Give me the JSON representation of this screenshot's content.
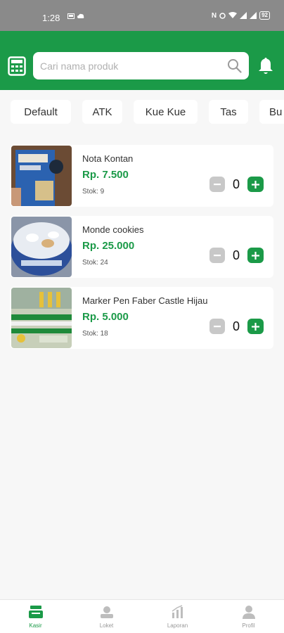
{
  "status_bar": {
    "time": "1:28",
    "battery": "92"
  },
  "search": {
    "placeholder": "Cari nama produk"
  },
  "categories": [
    "Default",
    "ATK",
    "Kue Kue",
    "Tas",
    "Bu"
  ],
  "products": [
    {
      "name": "Nota Kontan",
      "price": "Rp. 7.500",
      "stock": "Stok: 9",
      "qty": "0"
    },
    {
      "name": "Monde cookies",
      "price": "Rp. 25.000",
      "stock": "Stok: 24",
      "qty": "0"
    },
    {
      "name": "Marker Pen Faber Castle Hijau",
      "price": "Rp. 5.000",
      "stock": "Stok: 18",
      "qty": "0"
    }
  ],
  "nav": [
    {
      "label": "Kasir",
      "icon": "cash-register-icon",
      "active": true
    },
    {
      "label": "Loket",
      "icon": "counter-icon",
      "active": false
    },
    {
      "label": "Laporan",
      "icon": "report-chart-icon",
      "active": false
    },
    {
      "label": "Profil",
      "icon": "profile-icon",
      "active": false
    }
  ],
  "colors": {
    "primary": "#1b9a48",
    "status_bar": "#8a8a8a",
    "background": "#f7f7f7",
    "minus_button": "#c8c8c8"
  }
}
